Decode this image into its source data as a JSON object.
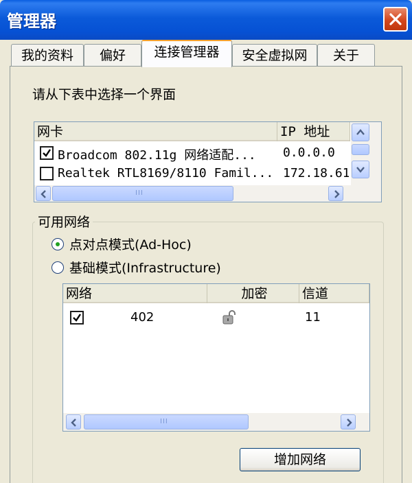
{
  "window": {
    "title": "管理器"
  },
  "tabs": [
    {
      "label": "我的资料"
    },
    {
      "label": "偏好"
    },
    {
      "label": "连接管理器"
    },
    {
      "label": "安全虚拟网"
    },
    {
      "label": "关于"
    }
  ],
  "interface_prompt": "请从下表中选择一个界面",
  "adapters": {
    "columns": [
      "网卡",
      "IP 地址"
    ],
    "rows": [
      {
        "checked": true,
        "name": "Broadcom 802.11g 网络适配...",
        "ip": "0.0.0.0"
      },
      {
        "checked": false,
        "name": "Realtek RTL8169/8110 Famil...",
        "ip": "172.18.61"
      }
    ],
    "scroll_grip": "III"
  },
  "available_networks": {
    "title": "可用网络",
    "modes": [
      {
        "label": "点对点模式(Ad-Hoc)",
        "selected": true
      },
      {
        "label": "基础模式(Infrastructure)",
        "selected": false
      }
    ],
    "columns": [
      "网络",
      "加密",
      "信道"
    ],
    "rows": [
      {
        "checked": true,
        "network": "402",
        "encryption_icon": "padlock-open-icon",
        "channel": "11"
      }
    ],
    "scroll_grip": "III",
    "add_button": "增加网络"
  },
  "colors": {
    "titlebar": "#0b5ad9",
    "close_button": "#d4471d",
    "active_tab_accent": "#f4a12f",
    "radio_selected": "#21a121"
  }
}
